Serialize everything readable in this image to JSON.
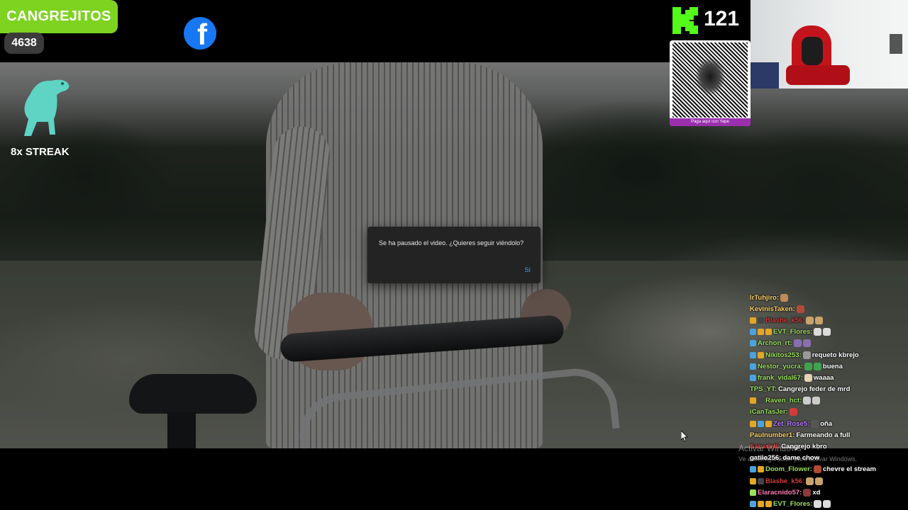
{
  "overlay": {
    "brand_name": "CANGREJITOS",
    "brand_count": "4638",
    "streak_label": "8x STREAK",
    "kick_viewers": "121",
    "qr_caption": "Paga aquí con Yape",
    "colors": {
      "brand_green": "#7ed321",
      "facebook_blue": "#1877f2",
      "kick_green": "#53fc18"
    }
  },
  "dialog": {
    "message": "Se ha pausado el video. ¿Quieres seguir viéndolo?",
    "confirm_label": "Sí"
  },
  "chat": {
    "messages": [
      {
        "user": "lrTuhjiro:",
        "text": "",
        "user_color": "#ffd166",
        "badges": [],
        "emotes": [
          "#c08a5a"
        ]
      },
      {
        "user": "KevinisTaken:",
        "text": "",
        "user_color": "#ffd166",
        "badges": [],
        "emotes": [
          "#b24a3a"
        ]
      },
      {
        "user": "Blashe_k56:",
        "text": "",
        "user_color": "#d23c3c",
        "badges": [
          "#e5a623",
          "#444"
        ],
        "emotes": [
          "#c9a36b",
          "#c9a36b"
        ]
      },
      {
        "user": "EVT_Flores:",
        "text": "",
        "user_color": "#9be15d",
        "badges": [
          "#4aa3df",
          "#e5a623",
          "#e5a623"
        ],
        "emotes": [
          "#dcdcdc",
          "#dcdcdc"
        ]
      },
      {
        "user": "Archon_rt:",
        "text": "",
        "user_color": "#9be15d",
        "badges": [
          "#4aa3df"
        ],
        "emotes": [
          "#8a6fb0",
          "#8a6fb0"
        ]
      },
      {
        "user": "Nikitos253:",
        "text": "requeto kbrejo",
        "user_color": "#9be15d",
        "badges": [
          "#4aa3df",
          "#e5a623"
        ],
        "emotes": [
          "#999"
        ]
      },
      {
        "user": "Nestor_yucra:",
        "text": "buena",
        "user_color": "#9be15d",
        "badges": [
          "#4aa3df"
        ],
        "emotes": [
          "#3fa34d",
          "#3fa34d"
        ]
      },
      {
        "user": "frank_vidal67:",
        "text": "waaaa",
        "user_color": "#9be15d",
        "badges": [
          "#4aa3df"
        ],
        "emotes": [
          "#e3d3b0"
        ]
      },
      {
        "user": "TPS_YT:",
        "text": "Cangrejo feder de mrd",
        "user_color": "#9be15d",
        "badges": [],
        "emotes": []
      },
      {
        "user": "Raven_hct:",
        "text": "",
        "user_color": "#9be15d",
        "badges": [
          "#e5a623",
          "#444"
        ],
        "emotes": [
          "#ccc",
          "#ccc"
        ]
      },
      {
        "user": "iCanTasJer:",
        "text": "",
        "user_color": "#9be15d",
        "badges": [],
        "emotes": [
          "#d23c3c"
        ]
      },
      {
        "user": "Zet_Rose5:",
        "text": "oña",
        "user_color": "#b57aff",
        "badges": [
          "#e5a623",
          "#4aa3df",
          "#e5a623"
        ],
        "emotes": [
          "#555"
        ]
      },
      {
        "user": "Paulnumber1:",
        "text": "Farmeando a full",
        "user_color": "#ffd166",
        "badges": [],
        "emotes": []
      },
      {
        "user": "Sabadell:",
        "text": "Cangrejo kbro",
        "user_color": "#d23c3c",
        "badges": [],
        "emotes": []
      },
      {
        "user": "gatilo256:",
        "text": "dame chow",
        "user_color": "#fff",
        "badges": [],
        "emotes": []
      },
      {
        "user": "Doom_Flower:",
        "text": "chevre el stream",
        "user_color": "#9be15d",
        "badges": [
          "#4aa3df",
          "#e5a623"
        ],
        "emotes": [
          "#b24a3a"
        ]
      },
      {
        "user": "Blashe_k56:",
        "text": "",
        "user_color": "#d23c3c",
        "badges": [
          "#e5a623",
          "#444"
        ],
        "emotes": [
          "#c9a36b",
          "#c9a36b"
        ]
      },
      {
        "user": "Elaracnido57:",
        "text": "xd",
        "user_color": "#ff7eb3",
        "badges": [
          "#9be15d"
        ],
        "emotes": [
          "#8a3a3a"
        ]
      },
      {
        "user": "EVT_Flores:",
        "text": "",
        "user_color": "#9be15d",
        "badges": [
          "#4aa3df",
          "#e5a623",
          "#e5a623"
        ],
        "emotes": [
          "#dcdcdc",
          "#dcdcdc"
        ]
      }
    ]
  },
  "system": {
    "watermark_title": "Activar Windows",
    "watermark_sub": "Ve a Configuración para activar Windows."
  }
}
